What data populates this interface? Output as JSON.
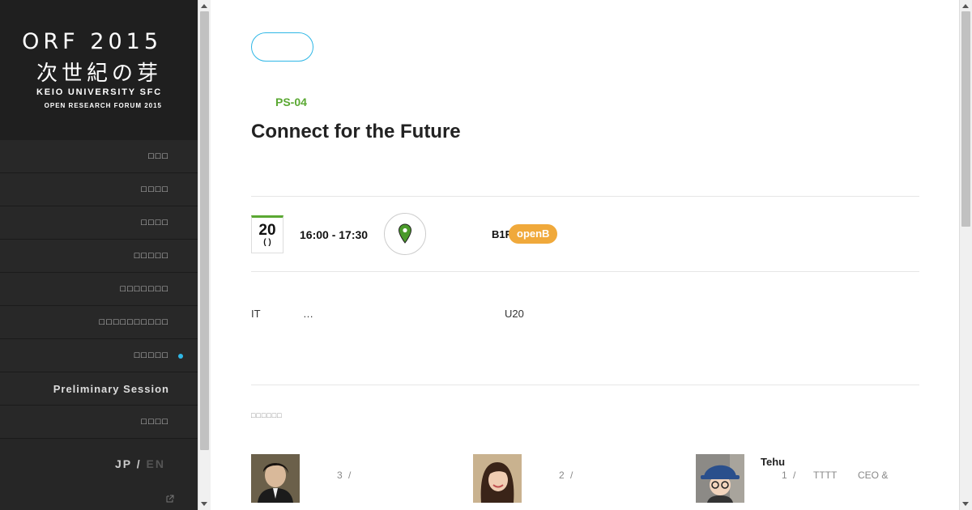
{
  "sidebar": {
    "logo": {
      "line1": "ORF 2015",
      "line2": "次世紀の芽",
      "line3": "KEIO UNIVERSITY SFC",
      "line4": "OPEN RESEARCH FORUM 2015"
    },
    "nav_items": [
      {
        "label": "□□□"
      },
      {
        "label": "□□□□"
      },
      {
        "label": "□□□□"
      },
      {
        "label": "□□□□□"
      },
      {
        "label": "□□□□□□□"
      },
      {
        "label": "□□□□□□□□□□"
      },
      {
        "label": "□□□□□",
        "active": true
      },
      {
        "label": "Preliminary Session"
      },
      {
        "label": "□□□□"
      }
    ],
    "lang": {
      "jp": "JP /",
      "en": "EN"
    },
    "external_icon": "external-link-icon"
  },
  "session": {
    "code": "PS-04",
    "title": "Connect for the Future",
    "date_day": "20",
    "date_dow": "( )",
    "time": "16:00 - 17:30",
    "location_icon": "map-pin-icon",
    "room": "B1F",
    "badge": "openB",
    "desc_1": "IT",
    "desc_2": "…",
    "desc_3": "U20"
  },
  "speakers_label": "□□□□□□",
  "speakers": [
    {
      "num": "3",
      "sep": "/",
      "name": "",
      "role": "",
      "role2": ""
    },
    {
      "num": "2",
      "sep": "/",
      "name": "",
      "role": "",
      "role2": ""
    },
    {
      "num": "1",
      "sep": "/",
      "name": "Tehu",
      "role": "TTTT",
      "role2": "CEO &"
    }
  ],
  "colors": {
    "accent_blue": "#2fb7e6",
    "green": "#5aa832",
    "badge_orange": "#f0a93b",
    "sidebar_bg": "#262626"
  }
}
